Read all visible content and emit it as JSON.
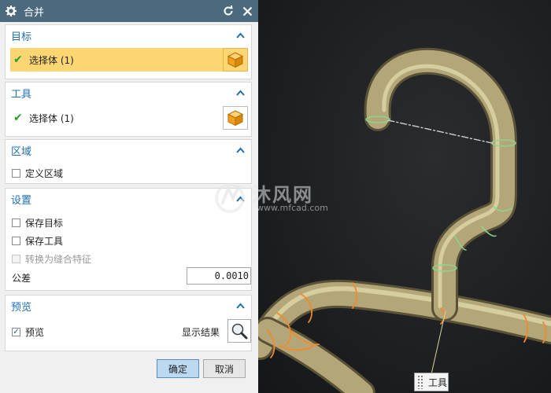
{
  "dialog": {
    "title": "合并",
    "target": {
      "heading": "目标",
      "select_label": "选择体 (1)"
    },
    "tool": {
      "heading": "工具",
      "select_label": "选择体 (1)"
    },
    "region": {
      "heading": "区域",
      "define_region_label": "定义区域",
      "define_region_checked": false
    },
    "settings": {
      "heading": "设置",
      "keep_target_label": "保存目标",
      "keep_target_checked": false,
      "keep_tool_label": "保存工具",
      "keep_tool_checked": false,
      "convert_label": "转换为缝合特征",
      "convert_checked": false,
      "convert_enabled": false,
      "tolerance_label": "公差",
      "tolerance_value": "0.0010"
    },
    "preview": {
      "heading": "预览",
      "preview_label": "预览",
      "preview_checked": true,
      "show_result_label": "显示结果"
    },
    "ok_label": "确定",
    "cancel_label": "取消"
  },
  "viewport": {
    "tool_tag": "工具",
    "watermark_text": "沐风网",
    "watermark_url": "www.mfcad.com"
  },
  "colors": {
    "titlebar": "#4b6a7e",
    "heading": "#1f6fae",
    "highlight": "#fcd672",
    "pipe": "#b3a77a",
    "edge_green": "#8cd68c",
    "edge_orange": "#f08a2a"
  }
}
